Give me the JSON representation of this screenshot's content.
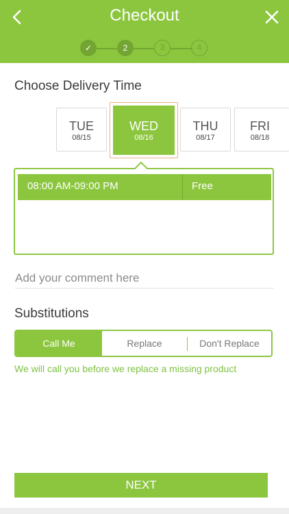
{
  "header": {
    "title": "Checkout",
    "steps": [
      {
        "label": "✓",
        "state": "done"
      },
      {
        "label": "2",
        "state": "active"
      },
      {
        "label": "3",
        "state": "pending"
      },
      {
        "label": "4",
        "state": "pending"
      }
    ],
    "accent_color": "#8cc63f"
  },
  "delivery": {
    "title": "Choose Delivery Time",
    "days": [
      {
        "name": "TUE",
        "date": "08/15",
        "selected": false
      },
      {
        "name": "WED",
        "date": "08/16",
        "selected": true
      },
      {
        "name": "THU",
        "date": "08/17",
        "selected": false
      },
      {
        "name": "FRI",
        "date": "08/18",
        "selected": false
      }
    ],
    "slots": [
      {
        "time": "08:00 AM-09:00 PM",
        "price": "Free",
        "selected": true
      }
    ]
  },
  "comment": {
    "placeholder": "Add your comment here",
    "value": ""
  },
  "substitutions": {
    "title": "Substitutions",
    "options": [
      "Call Me",
      "Replace",
      "Don't Replace"
    ],
    "selected": "Call Me",
    "note": "We will call you before we replace a missing product"
  },
  "footer": {
    "next_label": "NEXT"
  }
}
